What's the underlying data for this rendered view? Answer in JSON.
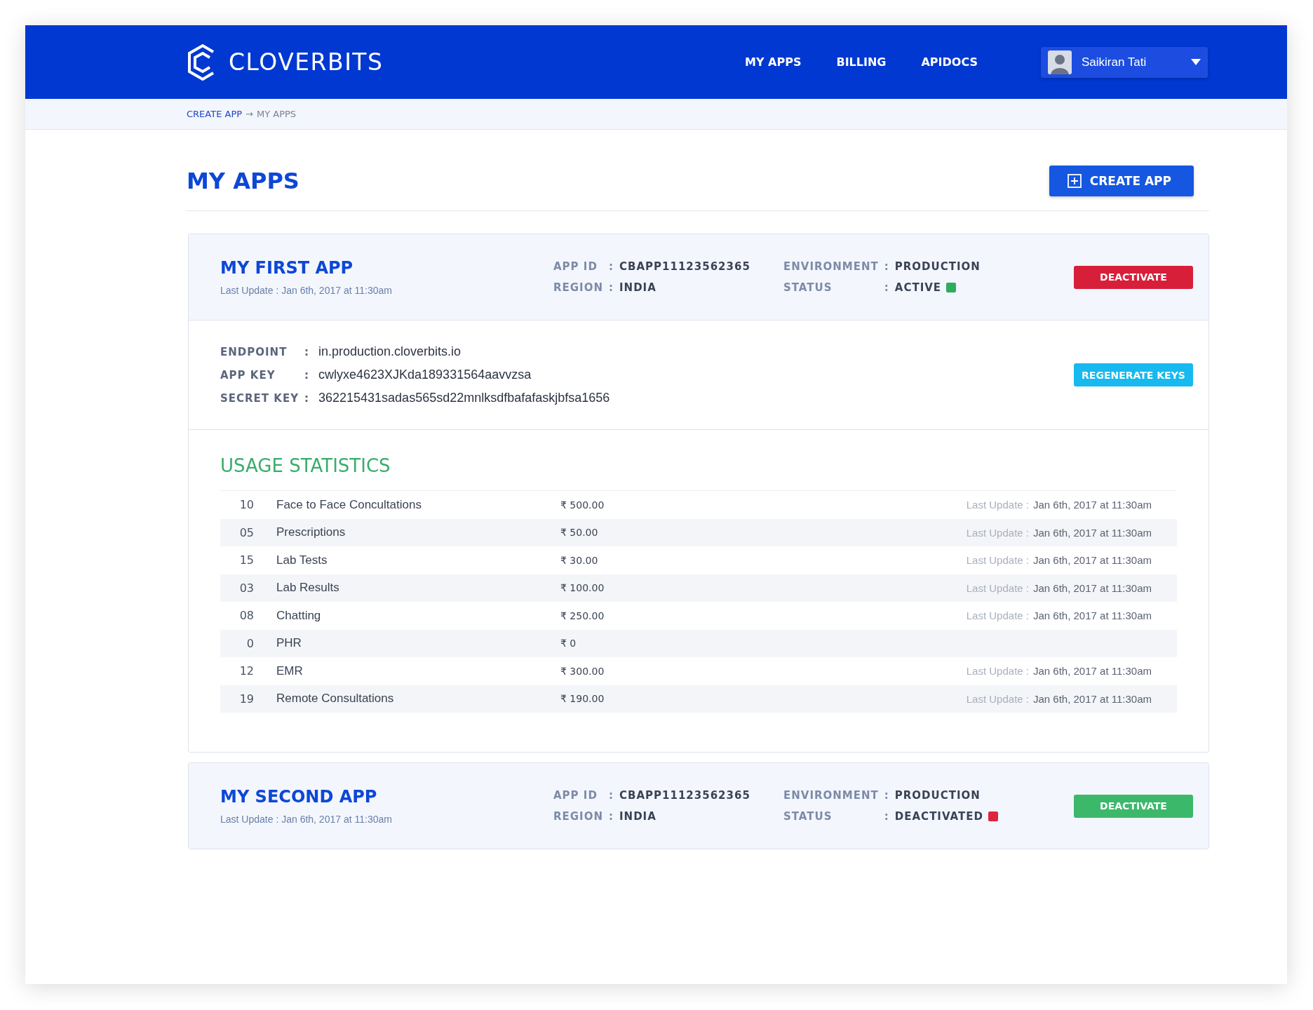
{
  "header": {
    "brand": "CLOVERBITS",
    "nav": [
      {
        "label": "MY APPS",
        "selected": false
      },
      {
        "label": "BILLING",
        "selected": false
      },
      {
        "label": "APIDOCS",
        "selected": false
      }
    ],
    "user": {
      "name": "Saikiran Tati"
    }
  },
  "breadcrumb": [
    {
      "label": "CREATE APP",
      "link": true
    },
    {
      "label": "→",
      "link": false
    },
    {
      "label": "MY APPS",
      "link": false
    }
  ],
  "page_title": "MY APPS",
  "create_button": "CREATE APP",
  "apps": [
    {
      "name": "MY FIRST APP",
      "last_update": "Last Update : Jan 6th, 2017 at 11:30am",
      "active": true,
      "expanded": true,
      "meta_left": [
        {
          "label": "APP ID",
          "sep": ":",
          "value": "CBAPP11123562365"
        },
        {
          "label": "REGION",
          "sep": ":",
          "value": "INDIA"
        }
      ],
      "meta_right": [
        {
          "label": "ENVIRONMENT",
          "sep": ":",
          "value": "PRODUCTION"
        },
        {
          "label": "STATUS",
          "sep": ":",
          "value": "ACTIVE"
        }
      ],
      "button": "DEACTIVATE",
      "keys": [
        {
          "label": "ENDPOINT",
          "sep": ":",
          "value": "in.production.cloverbits.io"
        },
        {
          "label": "APP KEY",
          "sep": ":",
          "value": "cwlyxe4623XJKda189331564aavvzsa"
        },
        {
          "label": "SECRET KEY",
          "sep": ":",
          "value": "362215431sadas565sd22mnlksdfbafafaskjbfsa1656"
        }
      ],
      "regenerate_button": "REGENERATE KEYS",
      "usage_title": "USAGE STATISTICS",
      "usage": [
        {
          "count": "10",
          "name": "Face to Face Concultations",
          "amount": "₹ 500.00",
          "update_label": "Last Update :",
          "update": "Jan 6th, 2017 at 11:30am"
        },
        {
          "count": "05",
          "name": "Prescriptions",
          "amount": "₹ 50.00",
          "update_label": "Last Update :",
          "update": "Jan 6th, 2017 at 11:30am"
        },
        {
          "count": "15",
          "name": "Lab Tests",
          "amount": "₹ 30.00",
          "update_label": "Last Update :",
          "update": "Jan 6th, 2017 at 11:30am"
        },
        {
          "count": "03",
          "name": "Lab Results",
          "amount": "₹ 100.00",
          "update_label": "Last Update :",
          "update": "Jan 6th, 2017 at 11:30am"
        },
        {
          "count": "08",
          "name": "Chatting",
          "amount": "₹ 250.00",
          "update_label": "Last Update :",
          "update": "Jan 6th, 2017 at 11:30am"
        },
        {
          "count": "0",
          "name": "PHR",
          "amount": "₹ 0"
        },
        {
          "count": "12",
          "name": "EMR",
          "amount": "₹ 300.00",
          "update_label": "Last Update :",
          "update": "Jan 6th, 2017 at 11:30am"
        },
        {
          "count": "19",
          "name": "Remote Consultations",
          "amount": "₹ 190.00",
          "update_label": "Last Update :",
          "update": "Jan 6th, 2017 at 11:30am"
        }
      ]
    },
    {
      "name": "MY SECOND APP",
      "last_update": "Last Update : Jan 6th, 2017 at 11:30am",
      "active": false,
      "expanded": false,
      "meta_left": [
        {
          "label": "APP ID",
          "sep": ":",
          "value": "CBAPP11123562365"
        },
        {
          "label": "REGION",
          "sep": ":",
          "value": "INDIA"
        }
      ],
      "meta_right": [
        {
          "label": "ENVIRONMENT",
          "sep": ":",
          "value": "PRODUCTION"
        },
        {
          "label": "STATUS",
          "sep": ":",
          "value": "DEACTIVATED"
        }
      ],
      "button": "DEACTIVATE"
    }
  ]
}
